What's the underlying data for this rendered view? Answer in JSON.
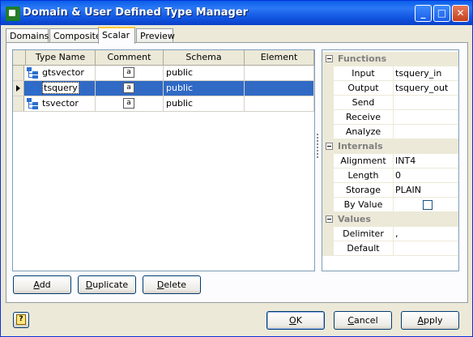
{
  "window": {
    "title": "Domain & User Defined Type Manager"
  },
  "tabs": [
    "Domains",
    "Composite",
    "Scalar",
    "Preview"
  ],
  "grid": {
    "columns": [
      "Type Name",
      "Comment",
      "Schema",
      "Element"
    ],
    "rows": [
      {
        "name": "gtsvector",
        "comment_icon": "a",
        "schema": "public",
        "element": ""
      },
      {
        "name": "tsquery",
        "comment_icon": "a",
        "schema": "public",
        "element": ""
      },
      {
        "name": "tsvector",
        "comment_icon": "a",
        "schema": "public",
        "element": ""
      }
    ],
    "selected_row": 1
  },
  "properties": {
    "functions": {
      "label": "Functions",
      "items": [
        {
          "name": "Input",
          "value": "tsquery_in"
        },
        {
          "name": "Output",
          "value": "tsquery_out"
        },
        {
          "name": "Send",
          "value": ""
        },
        {
          "name": "Receive",
          "value": ""
        },
        {
          "name": "Analyze",
          "value": ""
        }
      ]
    },
    "internals": {
      "label": "Internals",
      "items": [
        {
          "name": "Alignment",
          "value": "INT4"
        },
        {
          "name": "Length",
          "value": "0"
        },
        {
          "name": "Storage",
          "value": "PLAIN"
        },
        {
          "name": "By Value",
          "value": ""
        }
      ],
      "by_value_checked": false
    },
    "values": {
      "label": "Values",
      "items": [
        {
          "name": "Delimiter",
          "value": ","
        },
        {
          "name": "Default",
          "value": ""
        }
      ]
    }
  },
  "buttons": {
    "add": {
      "key": "A",
      "rest": "dd"
    },
    "duplicate": {
      "key": "D",
      "rest": "uplicate"
    },
    "delete": {
      "key": "D",
      "rest": "elete"
    },
    "ok": {
      "key": "O",
      "rest": "K"
    },
    "cancel": {
      "key": "C",
      "rest": "ancel"
    },
    "apply": {
      "key": "A",
      "rest": "pply"
    },
    "help_glyph": "?"
  },
  "colors": {
    "titlebar": "#0a5fe9",
    "selection": "#316ac5",
    "tab_highlight": "#ffc83c"
  }
}
